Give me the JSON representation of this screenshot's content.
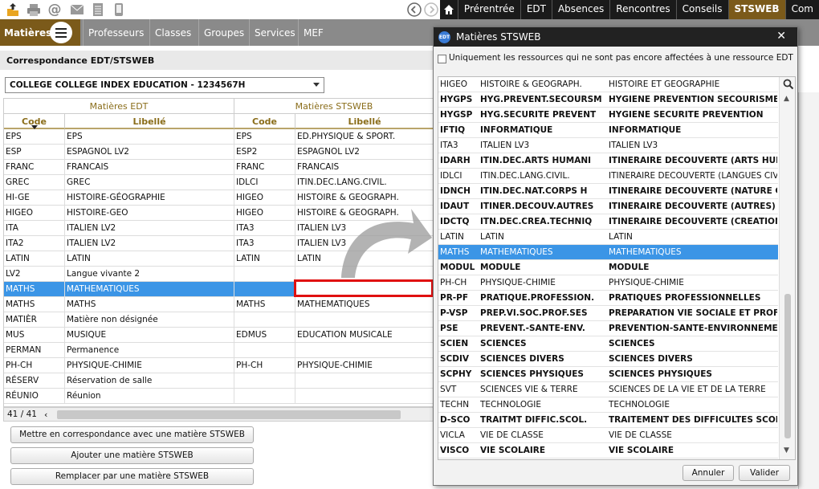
{
  "toolbar_icons": [
    "upload-icon",
    "print-icon",
    "at-icon",
    "mail-icon",
    "list-icon",
    "mobile-icon",
    "back-icon",
    "forward-icon",
    "search-icon"
  ],
  "top_tabs": [
    "Prérentrée",
    "EDT",
    "Absences",
    "Rencontres",
    "Conseils",
    "STSWEB",
    "Com"
  ],
  "active_tab": "STSWEB",
  "nav": {
    "current": "Matières",
    "items": [
      "Professeurs",
      "Classes",
      "Groupes",
      "Services",
      "MEF"
    ]
  },
  "section_title": "Correspondance EDT/STSWEB",
  "school_select": "COLLEGE COLLEGE INDEX EDUCATION - 1234567H",
  "grid": {
    "group_edt": "Matières EDT",
    "group_sts": "Matières STSWEB",
    "col_code": "Code",
    "col_libelle": "Libellé",
    "rows": [
      {
        "code": "EPS",
        "libelle": "EPS",
        "sts_code": "EPS",
        "sts_libelle": "ED.PHYSIQUE & SPORT."
      },
      {
        "code": "ESP",
        "libelle": "ESPAGNOL LV2",
        "sts_code": "ESP2",
        "sts_libelle": "ESPAGNOL LV2"
      },
      {
        "code": "FRANC",
        "libelle": "FRANCAIS",
        "sts_code": "FRANC",
        "sts_libelle": "FRANCAIS"
      },
      {
        "code": "GREC",
        "libelle": "GREC",
        "sts_code": "IDLCI",
        "sts_libelle": "ITIN.DEC.LANG.CIVIL."
      },
      {
        "code": "HI-GE",
        "libelle": "HISTOIRE-GÉOGRAPHIE",
        "sts_code": "HIGEO",
        "sts_libelle": "HISTOIRE & GEOGRAPH."
      },
      {
        "code": "HIGEO",
        "libelle": "HISTOIRE-GEO",
        "sts_code": "HIGEO",
        "sts_libelle": "HISTOIRE & GEOGRAPH."
      },
      {
        "code": "ITA",
        "libelle": "ITALIEN LV2",
        "sts_code": "ITA3",
        "sts_libelle": "ITALIEN LV3"
      },
      {
        "code": "ITA2",
        "libelle": "ITALIEN LV2",
        "sts_code": "ITA3",
        "sts_libelle": "ITALIEN LV3"
      },
      {
        "code": "LATIN",
        "libelle": "LATIN",
        "sts_code": "LATIN",
        "sts_libelle": "LATIN"
      },
      {
        "code": "LV2",
        "libelle": "Langue vivante 2",
        "sts_code": "",
        "sts_libelle": ""
      },
      {
        "code": "MATHS",
        "libelle": "MATHEMATIQUES",
        "sts_code": "",
        "sts_libelle": ""
      },
      {
        "code": "MATHS",
        "libelle": "MATHS",
        "sts_code": "MATHS",
        "sts_libelle": "MATHEMATIQUES"
      },
      {
        "code": "MATIÈR",
        "libelle": "Matière non désignée",
        "sts_code": "",
        "sts_libelle": ""
      },
      {
        "code": "MUS",
        "libelle": "MUSIQUE",
        "sts_code": "EDMUS",
        "sts_libelle": "EDUCATION MUSICALE"
      },
      {
        "code": "PERMAN",
        "libelle": "Permanence",
        "sts_code": "",
        "sts_libelle": ""
      },
      {
        "code": "PH-CH",
        "libelle": "PHYSIQUE-CHIMIE",
        "sts_code": "PH-CH",
        "sts_libelle": "PHYSIQUE-CHIMIE"
      },
      {
        "code": "RÉSERV",
        "libelle": "Réservation de salle",
        "sts_code": "",
        "sts_libelle": ""
      },
      {
        "code": "RÉUNIO",
        "libelle": "Réunion",
        "sts_code": "",
        "sts_libelle": ""
      }
    ],
    "selected_index": 10,
    "count": "41 / 41"
  },
  "buttons": {
    "match": "Mettre en correspondance avec une matière STSWEB",
    "add": "Ajouter une matière STSWEB",
    "replace": "Remplacer par une matière STSWEB"
  },
  "dialog": {
    "logo": "EDT",
    "title": "Matières STSWEB",
    "close": "✕",
    "checkbox_label": "Uniquement les ressources qui ne sont pas encore affectées à une ressource EDT",
    "checkbox_checked": false,
    "rows": [
      {
        "code": "HIGEO",
        "short": "HISTOIRE & GEOGRAPH.",
        "long": "HISTOIRE ET GEOGRAPHIE",
        "bold": false
      },
      {
        "code": "HYGPS",
        "short": "HYG.PREVENT.SECOURSM",
        "long": "HYGIENE PREVENTION SECOURISME",
        "bold": true
      },
      {
        "code": "HYGSP",
        "short": "HYG.SECURITE PREVENT",
        "long": "HYGIENE SECURITE PREVENTION",
        "bold": true
      },
      {
        "code": "IFTIQ",
        "short": "INFORMATIQUE",
        "long": "INFORMATIQUE",
        "bold": true
      },
      {
        "code": "ITA3",
        "short": "ITALIEN LV3",
        "long": "ITALIEN LV3",
        "bold": false
      },
      {
        "code": "IDARH",
        "short": "ITIN.DEC.ARTS HUMANI",
        "long": "ITINERAIRE DECOUVERTE (ARTS HUMANI",
        "bold": true
      },
      {
        "code": "IDLCI",
        "short": "ITIN.DEC.LANG.CIVIL.",
        "long": "ITINERAIRE DECOUVERTE (LANGUES CIVIL",
        "bold": false
      },
      {
        "code": "IDNCH",
        "short": "ITIN.DEC.NAT.CORPS H",
        "long": "ITINERAIRE DECOUVERTE (NATURE CORI",
        "bold": true
      },
      {
        "code": "IDAUT",
        "short": "ITINER.DECOUV.AUTRES",
        "long": "ITINERAIRE DECOUVERTE (AUTRES)",
        "bold": true
      },
      {
        "code": "IDCTQ",
        "short": "ITN.DEC.CREA.TECHNIQ",
        "long": "ITINERAIRE DECOUVERTE (CREATION TE",
        "bold": true
      },
      {
        "code": "LATIN",
        "short": "LATIN",
        "long": "LATIN",
        "bold": false
      },
      {
        "code": "MATHS",
        "short": "MATHEMATIQUES",
        "long": "MATHEMATIQUES",
        "bold": false
      },
      {
        "code": "MODUL",
        "short": "MODULE",
        "long": "MODULE",
        "bold": true
      },
      {
        "code": "PH-CH",
        "short": "PHYSIQUE-CHIMIE",
        "long": "PHYSIQUE-CHIMIE",
        "bold": false
      },
      {
        "code": "PR-PF",
        "short": "PRATIQUE.PROFESSION.",
        "long": "PRATIQUES PROFESSIONNELLES",
        "bold": true
      },
      {
        "code": "P-VSP",
        "short": "PREP.VI.SOC.PROF.SES",
        "long": "PREPARATION VIE SOCIALE ET PROF.(SE",
        "bold": true
      },
      {
        "code": "PSE",
        "short": "PREVENT.-SANTE-ENV.",
        "long": "PREVENTION-SANTE-ENVIRONNEMENT",
        "bold": true
      },
      {
        "code": "SCIEN",
        "short": "SCIENCES",
        "long": "SCIENCES",
        "bold": true
      },
      {
        "code": "SCDIV",
        "short": "SCIENCES DIVERS",
        "long": "SCIENCES DIVERS",
        "bold": true
      },
      {
        "code": "SCPHY",
        "short": "SCIENCES PHYSIQUES",
        "long": "SCIENCES PHYSIQUES",
        "bold": true
      },
      {
        "code": "SVT",
        "short": "SCIENCES VIE & TERRE",
        "long": "SCIENCES DE LA VIE ET DE LA TERRE",
        "bold": false
      },
      {
        "code": "TECHN",
        "short": "TECHNOLOGIE",
        "long": "TECHNOLOGIE",
        "bold": false
      },
      {
        "code": "D-SCO",
        "short": "TRAITMT DIFFIC.SCOL.",
        "long": "TRAITEMENT DES DIFFICULTES SCOLAII",
        "bold": true
      },
      {
        "code": "VICLA",
        "short": "VIE DE CLASSE",
        "long": "VIE DE CLASSE",
        "bold": false
      },
      {
        "code": "VISCO",
        "short": "VIE SCOLAIRE",
        "long": "VIE SCOLAIRE",
        "bold": true
      }
    ],
    "selected_index": 11,
    "cancel": "Annuler",
    "validate": "Valider"
  },
  "colors": {
    "brand": "#7b5a1a",
    "selection": "#3b95e6",
    "highlight": "#e01010",
    "header_text": "#8a6d1a"
  }
}
